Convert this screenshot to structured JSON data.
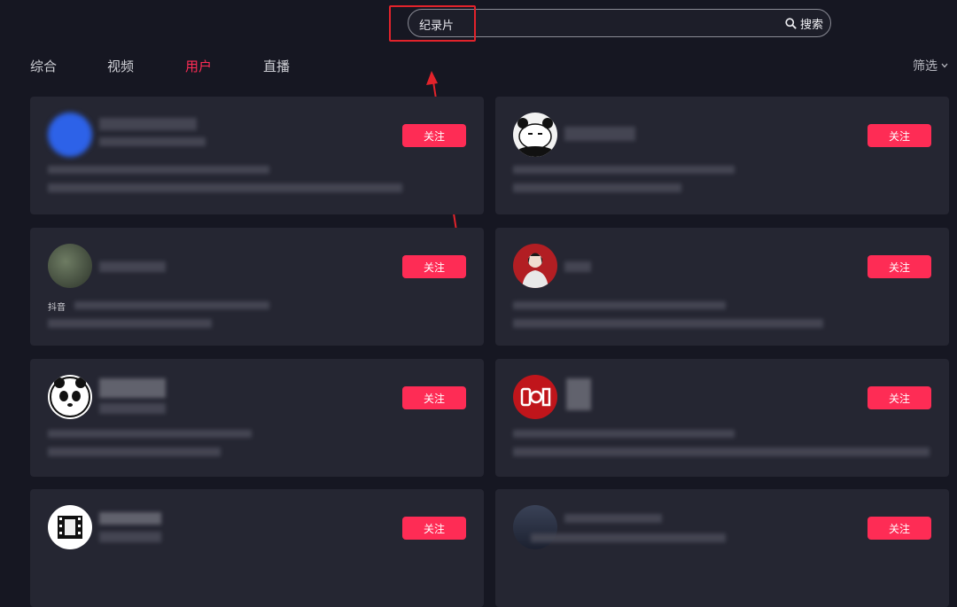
{
  "search": {
    "query": "纪录片",
    "button_label": "搜索"
  },
  "tabs": [
    {
      "label": "综合"
    },
    {
      "label": "视频"
    },
    {
      "label": "用户",
      "active": true
    },
    {
      "label": "直播"
    }
  ],
  "filter": {
    "label": "筛选"
  },
  "cards": [
    {
      "follow_label": "关注"
    },
    {
      "follow_label": "关注"
    },
    {
      "follow_label": "关注",
      "snippet": "抖音"
    },
    {
      "follow_label": "关注"
    },
    {
      "follow_label": "关注"
    },
    {
      "follow_label": "关注"
    },
    {
      "follow_label": "关注"
    },
    {
      "follow_label": "关注"
    }
  ],
  "colors": {
    "background": "#161722",
    "card": "#252632",
    "accent": "#fe2c55",
    "annotation": "#e2232b"
  }
}
